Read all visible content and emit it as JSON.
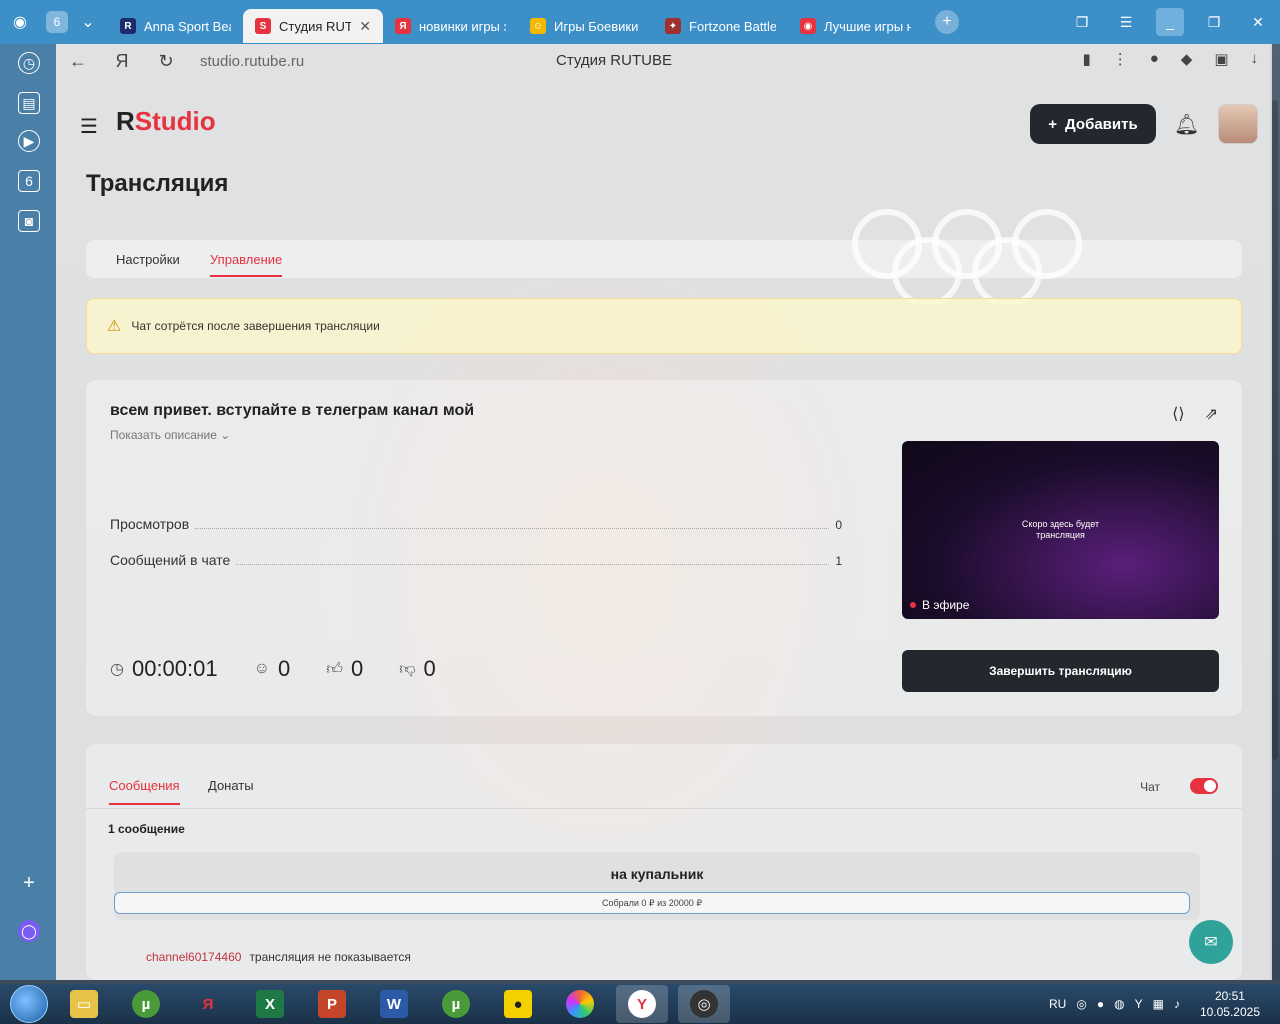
{
  "browser": {
    "tab_counter": "6",
    "tabs": [
      {
        "title": "Anna Sport Bea",
        "favicon": "R",
        "color": "#1d2b6e"
      },
      {
        "title": "Студия RUTU",
        "favicon": "S",
        "color": "#e6333f",
        "active": true
      },
      {
        "title": "новинки игры э",
        "favicon": "Я",
        "color": "#e6333f"
      },
      {
        "title": "Игры Боевики (",
        "favicon": "☺",
        "color": "#f4b800"
      },
      {
        "title": "Fortzone Battle",
        "favicon": "✦",
        "color": "#a03030"
      },
      {
        "title": "Лучшие игры н",
        "favicon": "◉",
        "color": "#e6333f"
      }
    ],
    "url": "studio.rutube.ru",
    "page_title": "Студия RUTUBE"
  },
  "header": {
    "logo_r": "R",
    "logo_studio": "Studio",
    "add_button": "Добавить"
  },
  "page": {
    "title": "Трансляция",
    "subtabs": [
      "Настройки",
      "Управление"
    ],
    "active_subtab": "Управление",
    "warning": "Чат сотрётся после завершения трансляции"
  },
  "stream": {
    "title": "всем привет. вступайте в телеграм канал мой",
    "show_description": "Показать описание",
    "stats": [
      {
        "label": "Просмотров",
        "value": "0"
      },
      {
        "label": "Сообщений в чате",
        "value": "1"
      }
    ],
    "timer": "00:00:01",
    "viewers": "0",
    "likes": "0",
    "dislikes": "0",
    "preview_text_line1": "Скоро здесь будет",
    "preview_text_line2": "трансляция",
    "onair_label": "В эфире",
    "end_button": "Завершить трансляцию"
  },
  "chat": {
    "tabs": [
      "Сообщения",
      "Донаты"
    ],
    "active_tab": "Сообщения",
    "toggle_label": "Чат",
    "toggle_on": true,
    "message_count": "1 сообщение",
    "donation": {
      "title": "на купальник",
      "progress_text": "Собрали 0 ₽ из 20000 ₽"
    },
    "messages": [
      {
        "user": "channel60174460",
        "text": "трансляция не показывается"
      }
    ]
  },
  "taskbar": {
    "language": "RU",
    "time": "20:51",
    "date": "10.05.2025"
  }
}
